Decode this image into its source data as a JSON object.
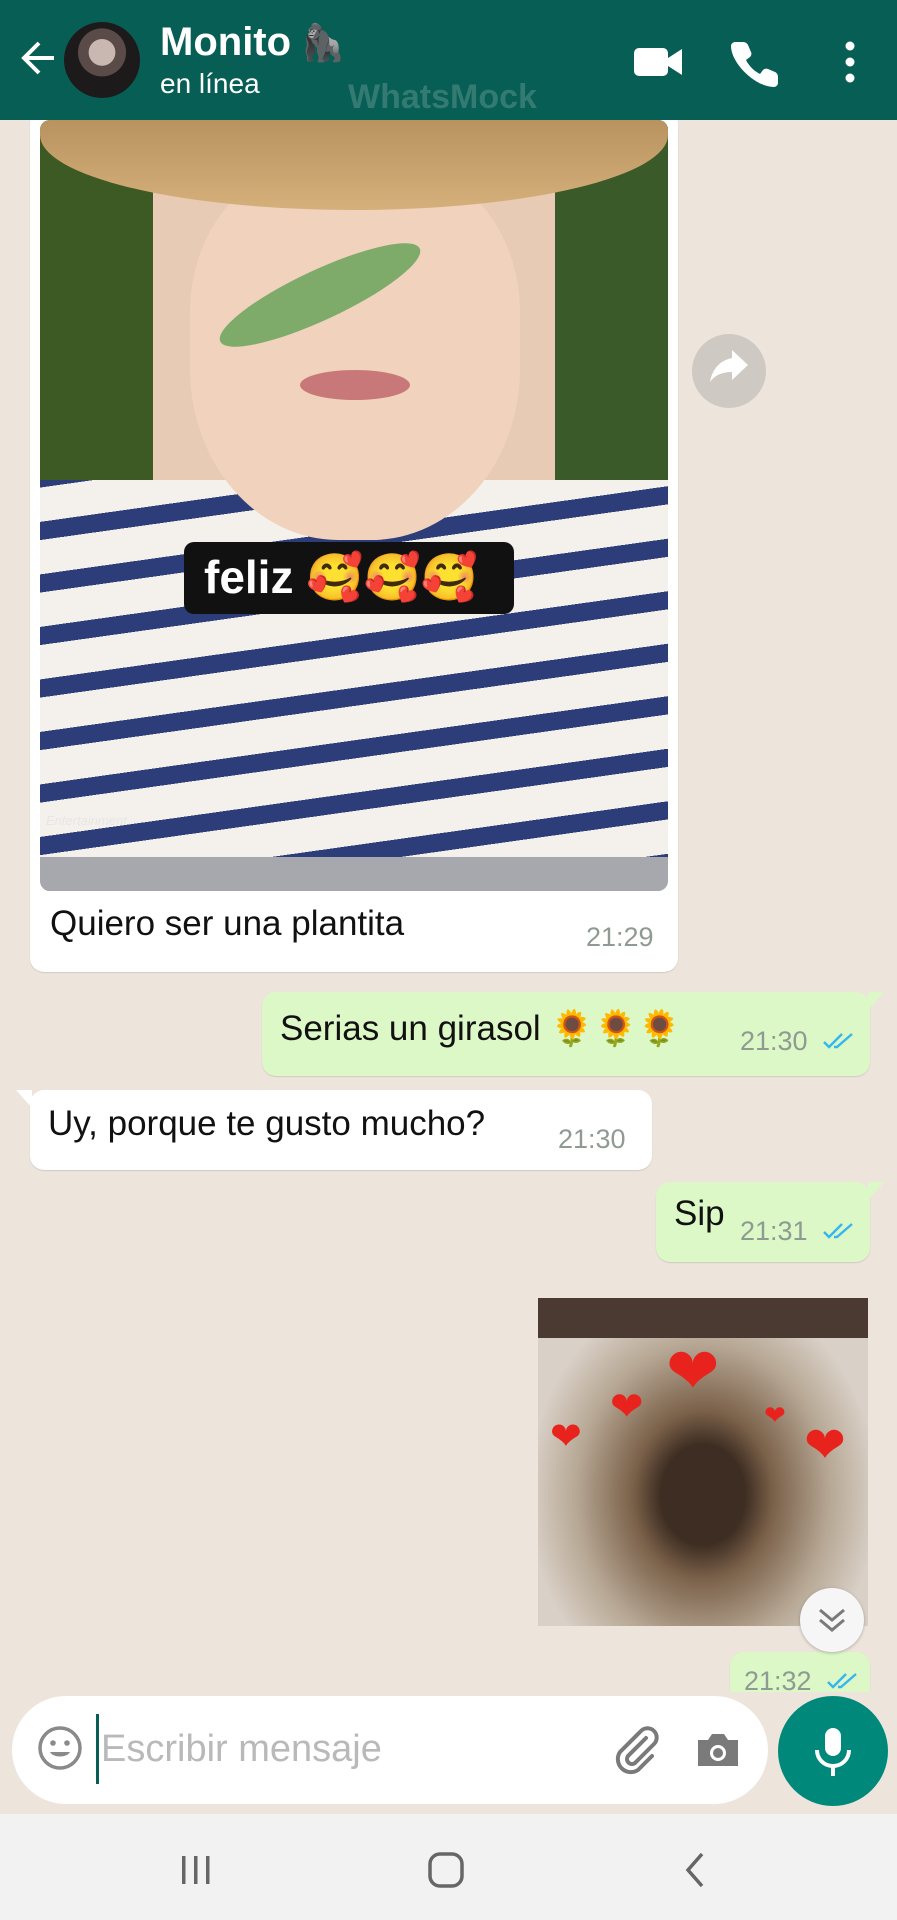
{
  "header": {
    "contact_name": "Monito",
    "contact_emoji": "🦍",
    "status": "en línea",
    "watermark": "WhatsMock",
    "icons": [
      "back-arrow-icon",
      "video-call-icon",
      "phone-call-icon",
      "more-options-icon"
    ],
    "color": "#075e54"
  },
  "messages": [
    {
      "direction": "incoming",
      "type": "image",
      "image_caption_overlay": "feliz 🥰🥰🥰",
      "image_watermark": "Entertainment",
      "text": "Quiero ser una plantita",
      "time": "21:29"
    },
    {
      "direction": "outgoing",
      "type": "text",
      "text": "Serias un girasol 🌻🌻🌻",
      "time": "21:30",
      "status": "read"
    },
    {
      "direction": "incoming",
      "type": "text",
      "text": "Uy, porque te gusto mucho?",
      "time": "21:30"
    },
    {
      "direction": "outgoing",
      "type": "text",
      "text": "Sip",
      "time": "21:31",
      "status": "read"
    },
    {
      "direction": "outgoing",
      "type": "sticker",
      "time": "21:32",
      "status": "read"
    }
  ],
  "input": {
    "placeholder": "Escribir mensaje",
    "value": ""
  },
  "colors": {
    "chat_background": "#ede5dc",
    "outgoing_bubble": "#dcf8c6",
    "incoming_bubble": "#ffffff",
    "read_ticks": "#34b7f1",
    "mic_button": "#00897b"
  }
}
